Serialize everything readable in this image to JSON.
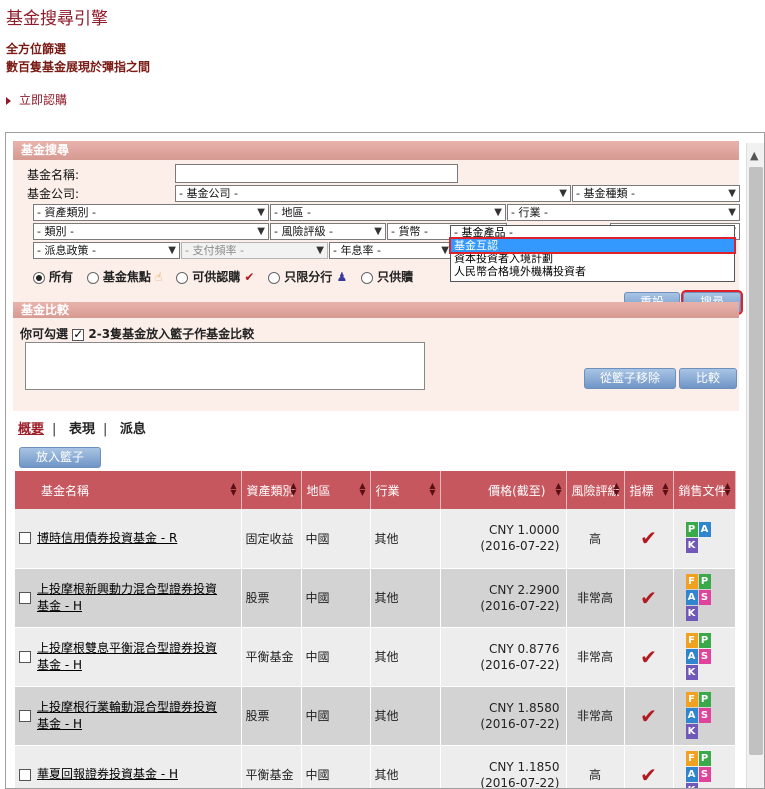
{
  "header": {
    "title": "基金搜尋引擎",
    "tagline1": "全方位篩選",
    "tagline2": "數百隻基金展現於彈指之間",
    "subscribe_link": "立即認購"
  },
  "search": {
    "panel_title": "基金搜尋",
    "fund_name_label": "基金名稱:",
    "fund_name_value": "",
    "company_label": "基金公司:",
    "company_value": "- 基金公司 -",
    "fund_type_value": "- 基金種類 -",
    "asset_class_value": "- 資產類別 -",
    "region_value": "- 地區 -",
    "industry_value": "- 行業 -",
    "category_value": "- 類別 -",
    "risk_value": "- 風險評級 -",
    "currency_value": "- 貨幣 -",
    "dividend_policy_value": "- 派息政策 -",
    "payment_freq_value": "- 支付頻率 -",
    "annual_rate_value": "- 年息率 -",
    "product_dropdown": {
      "options": [
        "- 基金產品 -",
        "基金互認",
        "資本投資者入境計劃",
        "人民幣合格境外機構投資者"
      ],
      "highlighted": "基金互認"
    },
    "radios": [
      {
        "label": "所有",
        "checked": true
      },
      {
        "label": "基金焦點",
        "checked": false
      },
      {
        "label": "可供認購",
        "checked": false
      },
      {
        "label": "只限分行",
        "checked": false
      },
      {
        "label": "只供贖",
        "checked": false
      }
    ],
    "reset_button": "重設",
    "search_button": "搜尋"
  },
  "compare": {
    "panel_title": "基金比較",
    "hint_prefix": "你可勾選",
    "hint_suffix": "2-3隻基金放入籃子作基金比較",
    "remove_button": "從籃子移除",
    "compare_button": "比較"
  },
  "tabs": [
    "概要",
    "表現",
    "派息"
  ],
  "add_basket_button": "放入籃子",
  "table": {
    "headers": [
      "基金名稱",
      "資產類別",
      "地區",
      "行業",
      "價格(截至)",
      "風險評級",
      "指標",
      "銷售文件"
    ],
    "rows": [
      {
        "name": "博時信用債券投資基金 - R",
        "asset": "固定收益",
        "region": "中國",
        "industry": "其他",
        "price": "CNY 1.0000",
        "date": "(2016-07-22)",
        "risk": "高",
        "docs": [
          "P",
          "A",
          "K"
        ]
      },
      {
        "name": "上投摩根新興動力混合型證券投資基金 - H",
        "asset": "股票",
        "region": "中國",
        "industry": "其他",
        "price": "CNY 2.2900",
        "date": "(2016-07-22)",
        "risk": "非常高",
        "docs": [
          "F",
          "P",
          "A",
          "S",
          "K"
        ]
      },
      {
        "name": "上投摩根雙息平衡混合型證券投資基金 - H",
        "asset": "平衡基金",
        "region": "中國",
        "industry": "其他",
        "price": "CNY 0.8776",
        "date": "(2016-07-22)",
        "risk": "非常高",
        "docs": [
          "F",
          "P",
          "A",
          "S",
          "K"
        ]
      },
      {
        "name": "上投摩根行業輪動混合型證券投資基金 - H",
        "asset": "股票",
        "region": "中國",
        "industry": "其他",
        "price": "CNY 1.8580",
        "date": "(2016-07-22)",
        "risk": "非常高",
        "docs": [
          "F",
          "P",
          "A",
          "S",
          "K"
        ]
      },
      {
        "name": "華夏回報證券投資基金 - H",
        "asset": "平衡基金",
        "region": "中國",
        "industry": "其他",
        "price": "CNY 1.1850",
        "date": "(2016-07-22)",
        "risk": "高",
        "docs": [
          "F",
          "P",
          "A",
          "S",
          "K"
        ]
      }
    ]
  }
}
